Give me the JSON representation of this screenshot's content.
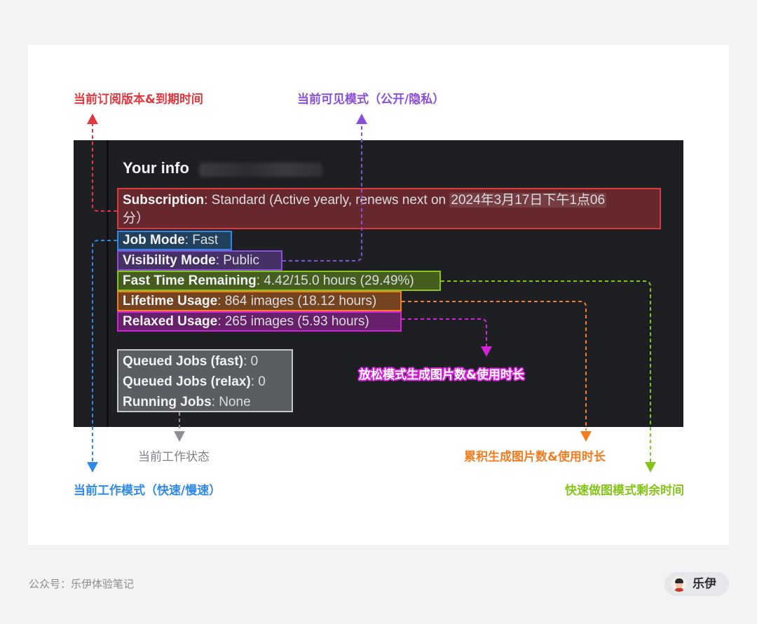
{
  "colors": {
    "subscription": "#e0383e",
    "visibility": "#8a4fd8",
    "job_mode": "#2e8ae6",
    "fast_time": "#86c41b",
    "lifetime": "#f57c1f",
    "relaxed": "#d424d8",
    "status": "#8c8f96",
    "panel_bg": "#1e1f22"
  },
  "discord": {
    "title": "Your info",
    "subscription": {
      "label": "Subscription",
      "value": ": Standard (Active yearly, renews next on ",
      "date": "2024年3月17日下午1点06",
      "date_cont": "分）"
    },
    "job_mode": {
      "label": "Job Mode",
      "value": ": Fast"
    },
    "visibility_mode": {
      "label": "Visibility Mode",
      "value": ": Public"
    },
    "fast_time_remaining": {
      "label": "Fast Time Remaining",
      "value": ": 4.42/15.0 hours (29.49%)"
    },
    "lifetime_usage": {
      "label": "Lifetime Usage",
      "value": ": 864 images (18.12 hours)"
    },
    "relaxed_usage": {
      "label": "Relaxed Usage",
      "value": ": 265 images (5.93 hours)"
    },
    "queued_fast": {
      "label": "Queued Jobs (fast)",
      "value": ": 0"
    },
    "queued_relax": {
      "label": "Queued Jobs (relax)",
      "value": ": 0"
    },
    "running_jobs": {
      "label": "Running Jobs",
      "value": ": None"
    }
  },
  "annotations": {
    "subscription": "当前订阅版本&到期时间",
    "visibility": "当前可见模式（公开/隐私）",
    "relaxed": "放松模式生成图片数&使用时长",
    "status": "当前工作状态",
    "lifetime": "累积生成图片数&使用时长",
    "job_mode": "当前工作模式（快速/慢速）",
    "fast_time": "快速做图模式剩余时间"
  },
  "footer": {
    "account": "公众号：乐伊体验笔记",
    "author": "乐伊"
  }
}
